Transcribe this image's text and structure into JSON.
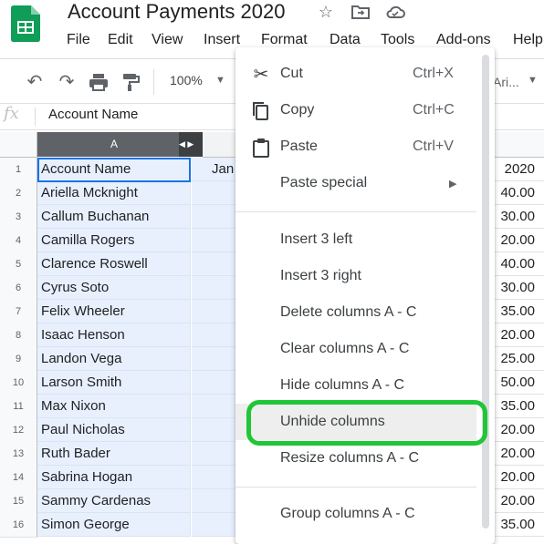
{
  "doc": {
    "title": "Account Payments 2020",
    "icons": [
      "sheets-logo",
      "star-icon",
      "move-to-folder-icon",
      "cloud-status-icon"
    ]
  },
  "menubar": {
    "items": [
      "File",
      "Edit",
      "View",
      "Insert",
      "Format",
      "Data",
      "Tools",
      "Add-ons",
      "Help"
    ]
  },
  "toolbar": {
    "icons": [
      "undo-icon",
      "redo-icon",
      "print-icon",
      "paint-format-icon"
    ],
    "zoom": "100%",
    "font_partial": "Ari..."
  },
  "formula_bar": {
    "fx": "fx",
    "content": "Account Name"
  },
  "grid": {
    "selected_column_header": "A",
    "row_numbers": [
      "1",
      "2",
      "3",
      "4",
      "5",
      "6",
      "7",
      "8",
      "9",
      "10",
      "11",
      "12",
      "13",
      "14",
      "15",
      "16"
    ],
    "column_a": [
      "Account Name",
      "Ariella Mcknight",
      "Callum Buchanan",
      "Camilla Rogers",
      "Clarence Roswell",
      "Cyrus Soto",
      "Felix Wheeler",
      "Isaac Henson",
      "Landon Vega",
      "Larson Smith",
      "Max Nixon",
      "Paul Nicholas",
      "Ruth Bader",
      "Sabrina Hogan",
      "Sammy Cardenas",
      "Simon George"
    ],
    "column_b_header_text": "Jan",
    "right_column": [
      "2020",
      "40.00",
      "30.00",
      "20.00",
      "40.00",
      "30.00",
      "35.00",
      "20.00",
      "25.00",
      "50.00",
      "35.00",
      "20.00",
      "20.00",
      "20.00",
      "20.00",
      "35.00"
    ]
  },
  "context_menu": {
    "cut": {
      "label": "Cut",
      "shortcut": "Ctrl+X",
      "icon": "scissors-icon"
    },
    "copy": {
      "label": "Copy",
      "shortcut": "Ctrl+C",
      "icon": "copy-icon"
    },
    "paste": {
      "label": "Paste",
      "shortcut": "Ctrl+V",
      "icon": "clipboard-icon"
    },
    "paste_special": "Paste special",
    "insert_left": "Insert 3 left",
    "insert_right": "Insert 3 right",
    "delete_cols": "Delete columns A - C",
    "clear_cols": "Clear columns A - C",
    "hide_cols": "Hide columns A - C",
    "unhide_cols": "Unhide columns",
    "resize_cols": "Resize columns A - C",
    "group_cols": "Group columns A - C",
    "highlight_color": "#1fc736"
  }
}
